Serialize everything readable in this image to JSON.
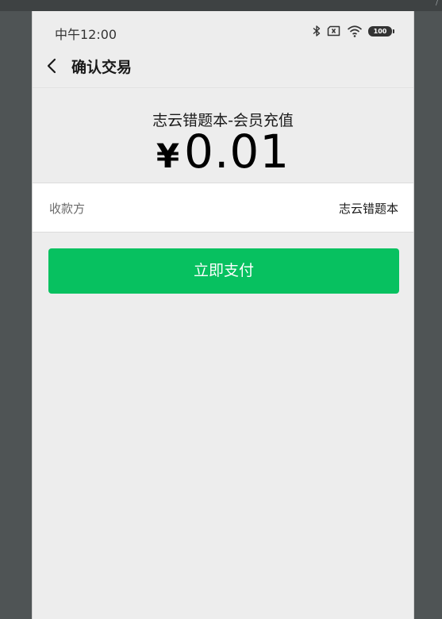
{
  "status_bar": {
    "time": "中午12:00",
    "battery_level": "100",
    "icons": [
      "bluetooth-icon",
      "sim-disabled-icon",
      "wifi-icon",
      "battery-icon"
    ]
  },
  "nav": {
    "title": "确认交易",
    "back_icon": "chevron-left-icon"
  },
  "summary": {
    "product_name": "志云错题本-会员充值",
    "currency_symbol": "¥",
    "amount": "0.01"
  },
  "payee": {
    "label": "收款方",
    "value": "志云错题本"
  },
  "actions": {
    "pay_label": "立即支付"
  },
  "colors": {
    "accent": "#07c160",
    "page_background": "#ededed",
    "outer_background": "#4f5455"
  }
}
